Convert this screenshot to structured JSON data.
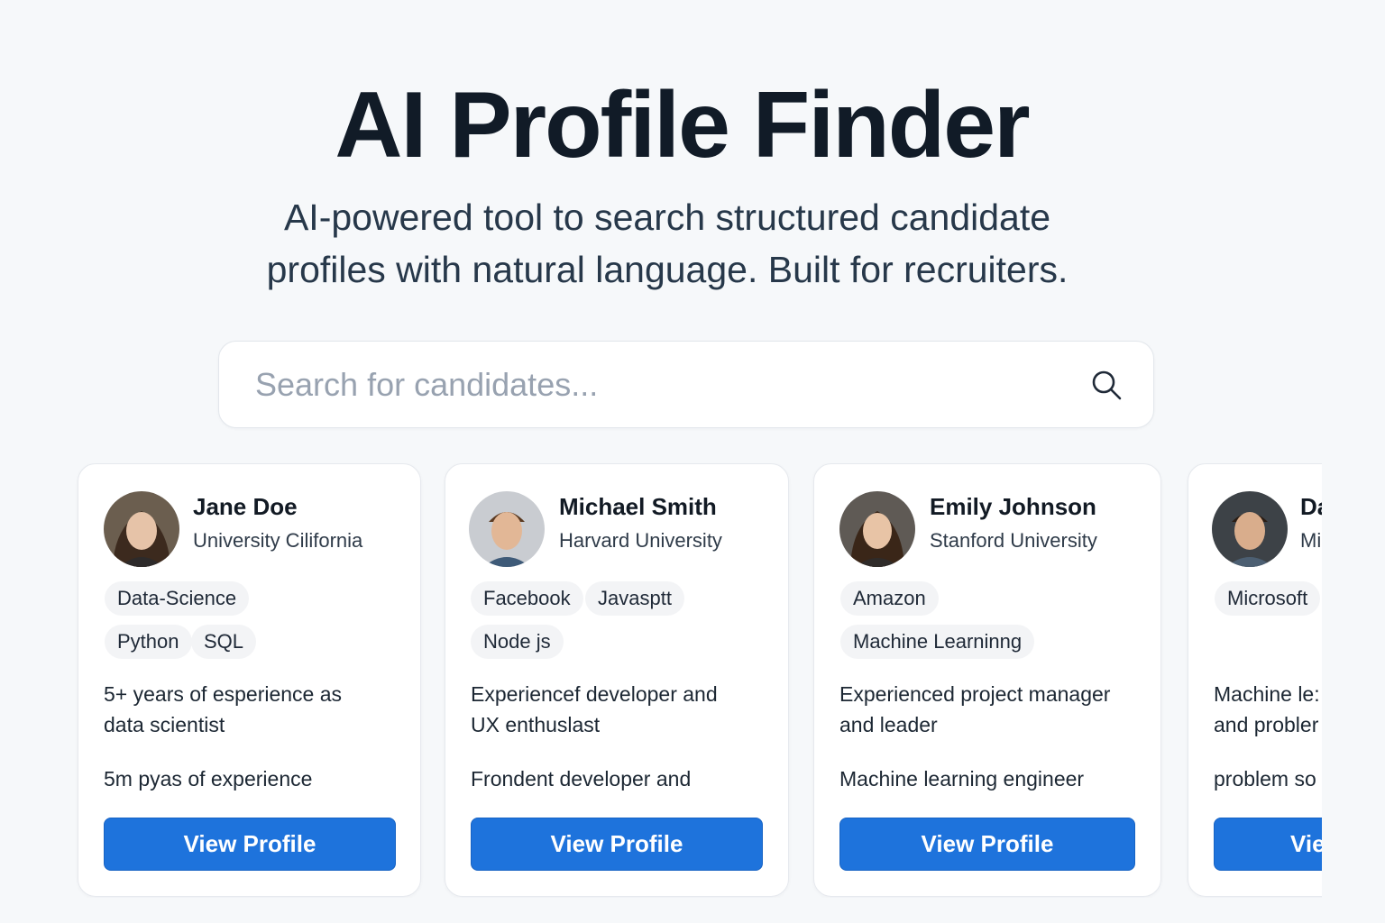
{
  "header": {
    "title": "AI Profile Finder",
    "subtitle_line1": "AI-powered tool to search structured candidate",
    "subtitle_line2": "profiles with natural language. Built for recruiters."
  },
  "search": {
    "placeholder": "Search for candidates...",
    "value": "",
    "icon": "search-icon"
  },
  "colors": {
    "background": "#f6f8fa",
    "button": "#1e73dc",
    "tag_bg": "#f3f4f6"
  },
  "candidates": [
    {
      "name": "Jane Doe",
      "school": "University Cilifornia",
      "tags": [
        "Data-Science",
        "Python",
        "SQL"
      ],
      "desc_line1": "5+ years of esperience as",
      "desc_line2": "data scientist",
      "note": "5m pyas of experience",
      "button": "View Profile"
    },
    {
      "name": "Michael Smith",
      "school": "Harvard University",
      "tags": [
        "Facebook",
        "Javasptt",
        "Node js"
      ],
      "desc_line1": "Experiencef developer and",
      "desc_line2": "UX enthuslast",
      "note": "Frondent developer and",
      "button": "View Profile"
    },
    {
      "name": "Emily Johnson",
      "school": "Stanford University",
      "tags": [
        "Amazon",
        "Machine Learninng"
      ],
      "desc_line1": "Experienced project manager",
      "desc_line2": "and leader",
      "note": "Machine learning engineer",
      "button": "View Profile"
    },
    {
      "name": "Da",
      "school": "Mi",
      "tags": [
        "Microsoft"
      ],
      "desc_line1": "Machine le:",
      "desc_line2": "and probler",
      "note": "problem so",
      "button": "Vie"
    }
  ]
}
